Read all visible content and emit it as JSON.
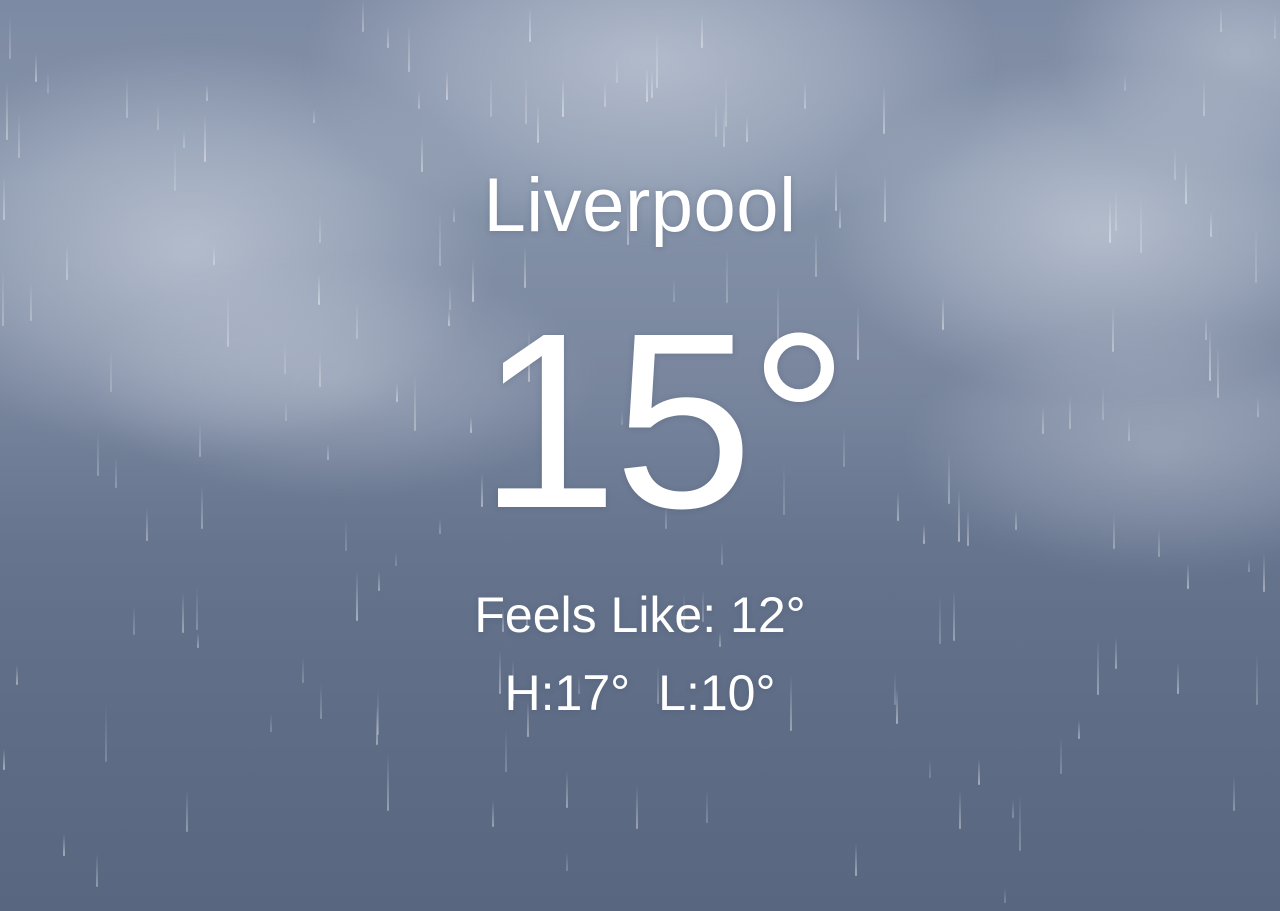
{
  "location": {
    "city": "Liverpool"
  },
  "current": {
    "temperature": "15°",
    "feels_like": "Feels Like: 12°",
    "high": "H:17°",
    "low": "L:10°"
  },
  "background": {
    "condition": "rain",
    "sky_top_color": "#7d8aa3",
    "sky_bottom_color": "#5d6b85"
  }
}
